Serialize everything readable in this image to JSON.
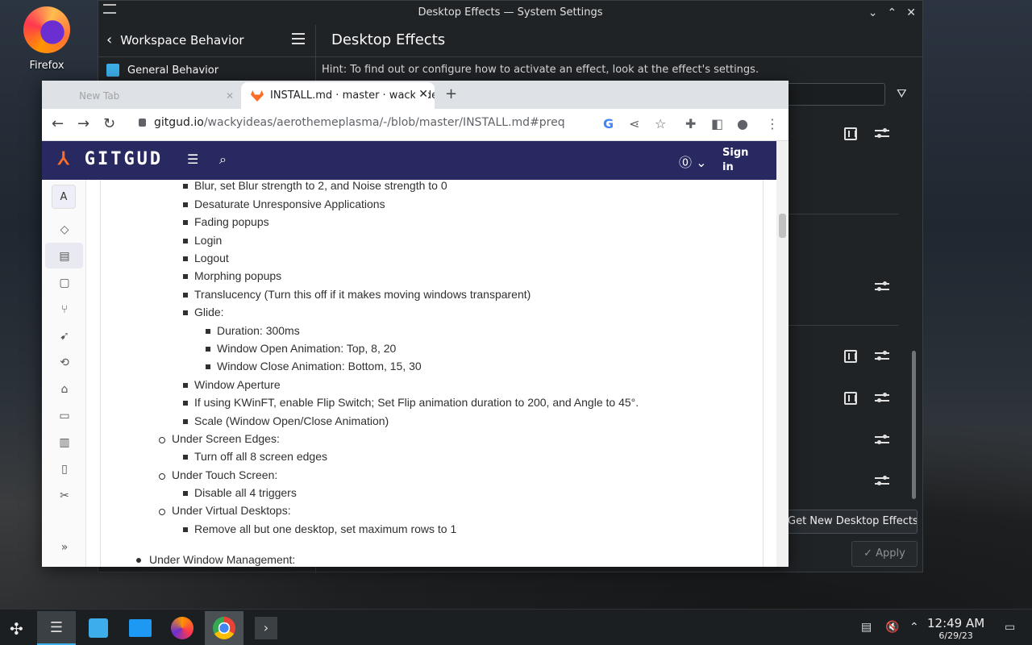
{
  "desktop": {
    "icon_label": "Firefox"
  },
  "settings": {
    "window_title": "Desktop Effects — System Settings",
    "back_label": "Workspace Behavior",
    "page_title": "Desktop Effects",
    "sidebar_item": "General Behavior",
    "hint": "Hint: To find out or configure how to activate an effect, look at the effect's settings.",
    "get_new": "Get New Desktop Effects...",
    "apply": "Apply"
  },
  "browser": {
    "inactive_tab": "New Tab",
    "active_tab": "INSTALL.md · master · wackyideas / aerothemeplasma",
    "url_host": "gitgud.io",
    "url_path": "/wackyideas/aerothemeplasma/-/blob/master/INSTALL.md#preq",
    "sign_in_1": "Sign",
    "sign_in_2": "in",
    "rail_avatar": "A",
    "logo": "GITGUD"
  },
  "content": {
    "lines": [
      "Blur, set Blur strength to 2, and Noise strength to 0",
      "Desaturate Unresponsive Applications",
      "Fading popups",
      "Login",
      "Logout",
      "Morphing popups",
      "Translucency (Turn this off if it makes moving windows transparent)",
      "Glide:",
      "Duration: 300ms",
      "Window Open Animation: Top, 8, 20",
      "Window Close Animation: Bottom, 15, 30",
      "Window Aperture",
      "If using KWinFT, enable Flip Switch; Set Flip animation duration to 200, and Angle to 45°.",
      "Scale (Window Open/Close Animation)",
      "Under Screen Edges:",
      "Turn off all 8 screen edges",
      "Under Touch Screen:",
      "Disable all 4 triggers",
      "Under Virtual Desktops:",
      "Remove all but one desktop, set maximum rows to 1",
      "Under Window Management:"
    ]
  },
  "taskbar": {
    "time": "12:49 AM",
    "date": "6/29/23"
  }
}
